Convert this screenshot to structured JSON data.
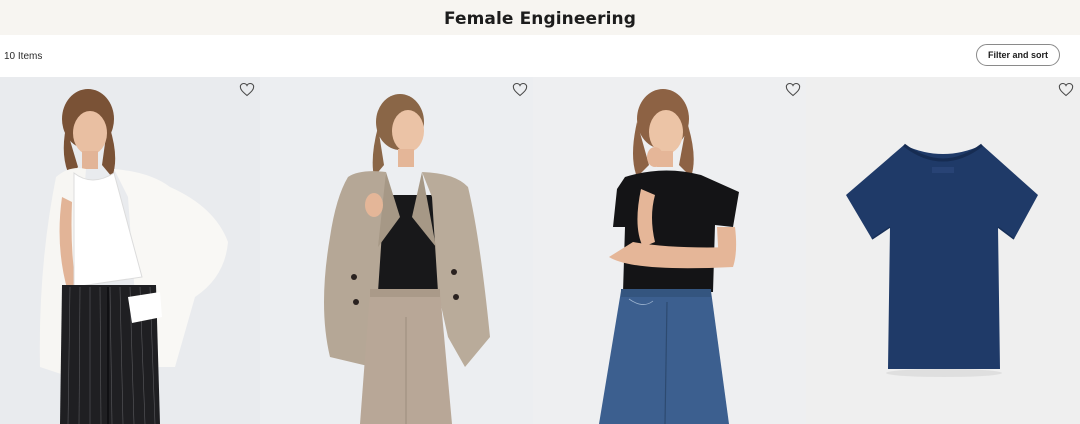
{
  "header": {
    "title": "Female Engineering"
  },
  "toolbar": {
    "item_count": "10 Items",
    "filter_label": "Filter and sort"
  },
  "products": [
    {
      "image": "model-white-tank-blazer-pinstripe-trousers",
      "wishlist_icon": "heart-outline-icon"
    },
    {
      "image": "model-beige-blazer-black-tank",
      "wishlist_icon": "heart-outline-icon"
    },
    {
      "image": "model-black-tee-blue-jeans",
      "wishlist_icon": "heart-outline-icon"
    },
    {
      "image": "navy-tshirt-flatlay",
      "wishlist_icon": "heart-outline-icon"
    }
  ],
  "colors": {
    "header_bg": "#f7f5f1",
    "photo_bg": "#eceef0"
  }
}
